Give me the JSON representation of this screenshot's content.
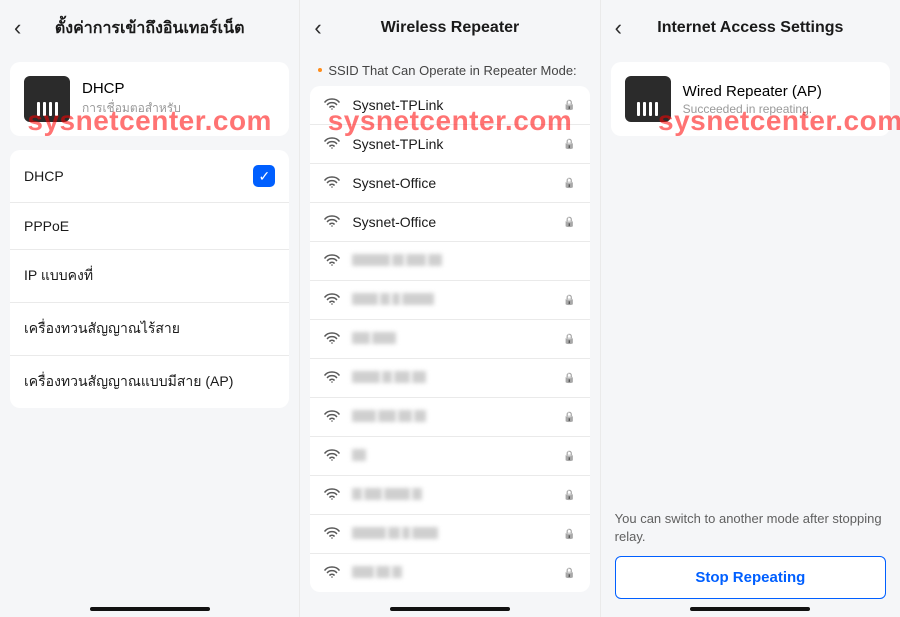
{
  "watermark": "sysnetcenter.com",
  "phone1": {
    "title": "ตั้งค่าการเข้าถึงอินเทอร์เน็ต",
    "currentMode": "DHCP",
    "currentSub": "การเชื่อมตอสำหรับ",
    "options": [
      "DHCP",
      "PPPoE",
      "IP แบบคงที่",
      "เครื่องทวนสัญญาณไร้สาย",
      "เครื่องทวนสัญญาณแบบมีสาย (AP)"
    ],
    "selectedIndex": 0
  },
  "phone2": {
    "title": "Wireless Repeater",
    "sectionLabel": "SSID That Can Operate in Repeater Mode:",
    "networks": [
      {
        "name": "Sysnet-TPLink",
        "locked": true,
        "blurred": false
      },
      {
        "name": "Sysnet-TPLink",
        "locked": true,
        "blurred": false
      },
      {
        "name": "Sysnet-Office",
        "locked": true,
        "blurred": false
      },
      {
        "name": "Sysnet-Office",
        "locked": true,
        "blurred": false
      },
      {
        "locked": false,
        "blurred": true,
        "pattern": [
          38,
          12,
          20,
          14
        ]
      },
      {
        "locked": true,
        "blurred": true,
        "pattern": [
          26,
          10,
          8,
          32
        ]
      },
      {
        "locked": true,
        "blurred": true,
        "pattern": [
          18,
          24
        ]
      },
      {
        "locked": true,
        "blurred": true,
        "pattern": [
          28,
          10,
          16,
          14
        ]
      },
      {
        "locked": true,
        "blurred": true,
        "pattern": [
          24,
          18,
          14,
          12
        ]
      },
      {
        "locked": true,
        "blurred": true,
        "pattern": [
          14
        ]
      },
      {
        "locked": true,
        "blurred": true,
        "pattern": [
          10,
          18,
          26,
          10
        ]
      },
      {
        "locked": true,
        "blurred": true,
        "pattern": [
          34,
          12,
          8,
          26
        ]
      },
      {
        "locked": true,
        "blurred": true,
        "pattern": [
          22,
          14,
          10
        ]
      }
    ]
  },
  "phone3": {
    "title": "Internet Access Settings",
    "currentMode": "Wired Repeater (AP)",
    "currentSub": "Succeeded in repeating.",
    "hint": "You can switch to another mode after stopping relay.",
    "button": "Stop Repeating"
  }
}
